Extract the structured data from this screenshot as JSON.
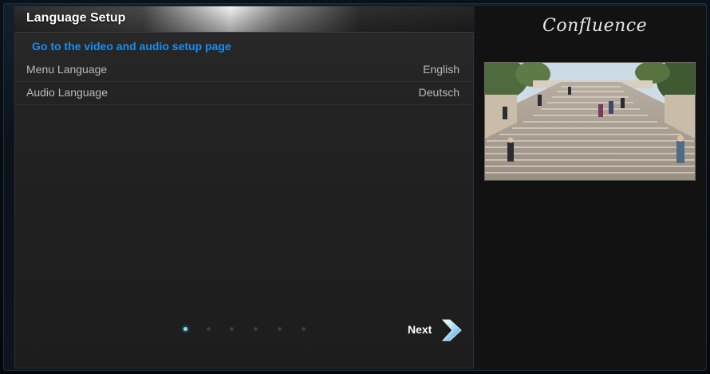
{
  "dialog": {
    "title": "Language Setup",
    "link_text": "Go to the video and audio setup page"
  },
  "settings": [
    {
      "label": "Menu Language",
      "value": "English"
    },
    {
      "label": "Audio Language",
      "value": "Deutsch"
    }
  ],
  "pager": {
    "total_pages": 6,
    "current_page": 1
  },
  "navigation": {
    "next_label": "Next"
  },
  "branding": {
    "logo_text": "Confluence"
  },
  "colors": {
    "accent_link": "#1a8ef0",
    "active_dot": "#8fd8ff",
    "next_arrow": "#9fd6f2"
  },
  "icons": {
    "next": "chevron-right-icon",
    "pager_dot": "pager-dot-icon"
  }
}
